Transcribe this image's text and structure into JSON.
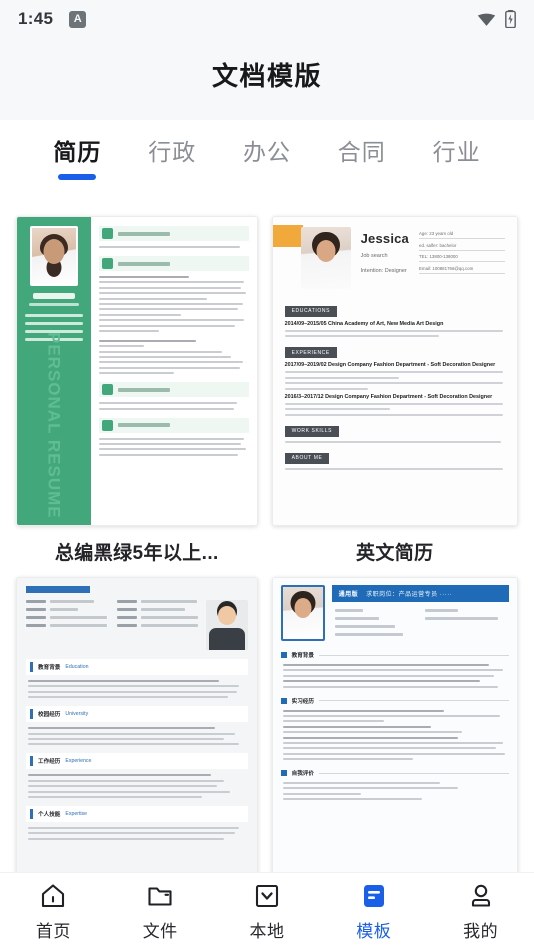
{
  "status_bar": {
    "time": "1:45",
    "app_badge_letter": "A",
    "wifi_icon": "wifi-icon",
    "battery_icon": "battery-charging-icon"
  },
  "header": {
    "title": "文档模版"
  },
  "tabs": [
    {
      "label": "简历",
      "active": true
    },
    {
      "label": "行政",
      "active": false
    },
    {
      "label": "办公",
      "active": false
    },
    {
      "label": "合同",
      "active": false
    },
    {
      "label": "行业",
      "active": false
    }
  ],
  "templates": [
    {
      "title": "总编黑绿5年以上...",
      "style": "green-sidebar",
      "accent": "#43a77c",
      "vertical_text": "PERSONAL RESUME"
    },
    {
      "title": "英文简历",
      "style": "english-minimal",
      "accent": "#f2a93b",
      "name": "Jessica",
      "role_lines": [
        "Job search",
        "Intention: Designer"
      ],
      "contact": [
        "Age:  23 years old",
        "ed. salfer: bachelor",
        "TEL:  13800-138000",
        "Email:  100881766@qq.com"
      ],
      "sections": [
        {
          "tag": "EDUCATIONS",
          "heading": "2014/09–2015/05   China Academy of Art, New Media Art Design",
          "lines": 2
        },
        {
          "tag": "EXPERIENCE",
          "heading": "2017/09–2019/02   Design Company Fashion Department - Soft Decoration Designer",
          "lines": 4
        },
        {
          "tag": "",
          "heading": "2016/3–2017/12   Design Company Fashion Department - Soft Decoration Designer",
          "lines": 3
        },
        {
          "tag": "WORK SKILLS",
          "heading": "",
          "lines": 1
        },
        {
          "tag": "ABOUT ME",
          "heading": "",
          "lines": 1
        }
      ]
    },
    {
      "title": "",
      "style": "blue-gray-male",
      "accent": "#2f6fb5",
      "sections": [
        {
          "cn": "教育背景",
          "en": "Education"
        },
        {
          "cn": "校园经历",
          "en": "University"
        },
        {
          "cn": "工作经历",
          "en": "Experience"
        },
        {
          "cn": "个人技能",
          "en": "Expertise"
        }
      ]
    },
    {
      "title": "",
      "style": "blue-banner",
      "accent": "#1f6bb8",
      "banner_name": "通用版",
      "banner_sub": "求职岗位：产品运营专员 ·····",
      "sections": [
        {
          "cn": "教育背景"
        },
        {
          "cn": "实习经历"
        },
        {
          "cn": "自我评价"
        }
      ]
    }
  ],
  "bottom_nav": [
    {
      "label": "首页",
      "icon": "home-icon",
      "active": false
    },
    {
      "label": "文件",
      "icon": "folder-icon",
      "active": false
    },
    {
      "label": "本地",
      "icon": "download-box-icon",
      "active": false
    },
    {
      "label": "模板",
      "icon": "template-doc-icon",
      "active": true
    },
    {
      "label": "我的",
      "icon": "person-icon",
      "active": false
    }
  ],
  "colors": {
    "accent_blue": "#1a5fe8",
    "header_bg": "#f7f8f9",
    "page_bg": "#ffffff",
    "text_primary": "#17181a",
    "text_muted": "#8a8f96"
  }
}
